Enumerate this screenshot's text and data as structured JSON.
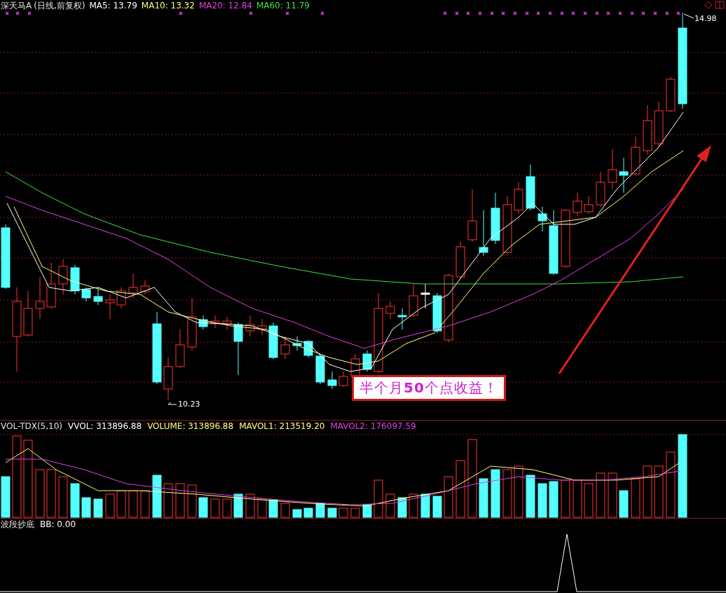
{
  "header": {
    "stock": "深天马A",
    "period": "(日线,前复权)",
    "indicators": [
      {
        "label": "MA5: 13.79",
        "color": "#ffffff"
      },
      {
        "label": "MA10: 13.32",
        "color": "#ffff80"
      },
      {
        "label": "MA20: 12.84",
        "color": "#e040e0"
      },
      {
        "label": "MA60: 11.79",
        "color": "#40e040"
      }
    ]
  },
  "price_labels": {
    "high": "14.98",
    "low": "10.23"
  },
  "annotation": {
    "text": "半个月**50**个点收益！"
  },
  "volume_panel": {
    "title": "VOL-TDX(5,10)",
    "indicators": [
      {
        "label": "VVOL: 313896.88",
        "color": "#ffffff"
      },
      {
        "label": "VOLUME: 313896.88",
        "color": "#ffff80"
      },
      {
        "label": "MAVOL1: 213519.20",
        "color": "#ffff80"
      },
      {
        "label": "MAVOL2: 176097.59",
        "color": "#e040e0"
      }
    ]
  },
  "indicator_panel": {
    "title": "波段抄底",
    "indicators": [
      {
        "label": "BB: 0.00",
        "color": "#ffffff"
      }
    ]
  }
}
